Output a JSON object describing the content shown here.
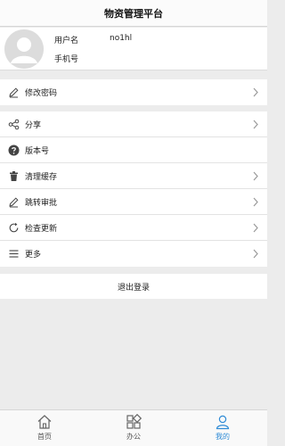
{
  "header": {
    "title": "物资管理平台"
  },
  "profile": {
    "username_label": "用户名",
    "username_value": "no1hl",
    "phone_label": "手机号"
  },
  "menu_top": [
    {
      "label": "修改密码",
      "icon": "pencil-icon"
    }
  ],
  "menu_main": [
    {
      "label": "分享",
      "icon": "share-icon"
    },
    {
      "label": "版本号",
      "icon": "help-icon"
    },
    {
      "label": "清理缓存",
      "icon": "trash-icon"
    },
    {
      "label": "跳转审批",
      "icon": "pencil-icon"
    },
    {
      "label": "检查更新",
      "icon": "refresh-icon"
    },
    {
      "label": "更多",
      "icon": "menu-icon"
    }
  ],
  "logout": {
    "label": "退出登录"
  },
  "tabbar": {
    "tabs": [
      {
        "label": "首页",
        "icon": "home-icon"
      },
      {
        "label": "办公",
        "icon": "grid-icon"
      },
      {
        "label": "我的",
        "icon": "user-icon"
      }
    ],
    "active_index": 2,
    "active_color": "#2f8bd6"
  }
}
